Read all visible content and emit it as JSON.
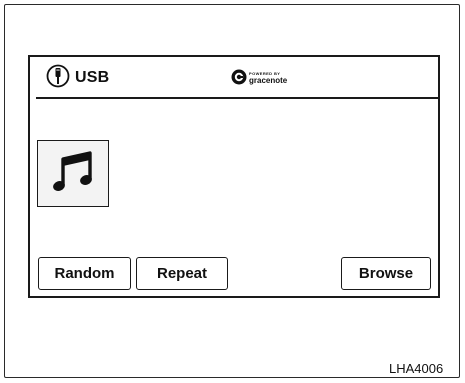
{
  "header": {
    "source_icon": "usb-plug-icon",
    "source_label": "USB",
    "gracenote": {
      "icon": "gracenote-logo-icon",
      "powered_by": "POWERED BY",
      "brand": "gracenote"
    }
  },
  "album_art": {
    "icon": "music-note-icon"
  },
  "buttons": {
    "random_label": "Random",
    "repeat_label": "Repeat",
    "browse_label": "Browse"
  },
  "figure_code": "LHA4006"
}
